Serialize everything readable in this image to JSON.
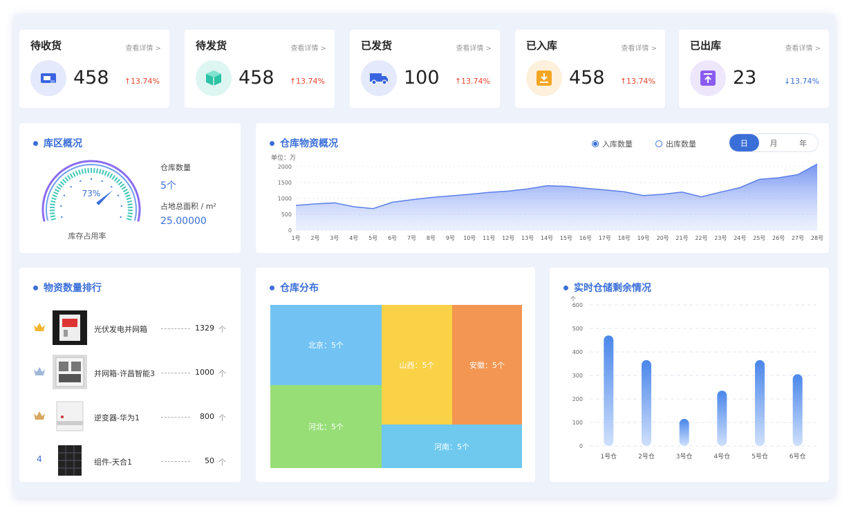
{
  "stats": [
    {
      "title": "待收货",
      "link": "查看详情 >",
      "value": "458",
      "change": "13.74%",
      "direction": "up",
      "icon": "inbox-icon",
      "icon_bg": "#e4e9fb",
      "icon_color": "#3a63e0"
    },
    {
      "title": "待发货",
      "link": "查看详情 >",
      "value": "458",
      "change": "13.74%",
      "direction": "up",
      "icon": "package-icon",
      "icon_bg": "#ddf6f1",
      "icon_color": "#2cc2a5"
    },
    {
      "title": "已发货",
      "link": "查看详情 >",
      "value": "100",
      "change": "13.74%",
      "direction": "up",
      "icon": "truck-icon",
      "icon_bg": "#e4e9fb",
      "icon_color": "#3a63e0"
    },
    {
      "title": "已入库",
      "link": "查看详情 >",
      "value": "458",
      "change": "13.74%",
      "direction": "up",
      "icon": "download-icon",
      "icon_bg": "#fdf0dc",
      "icon_color": "#f5a623"
    },
    {
      "title": "已出库",
      "link": "查看详情 >",
      "value": "23",
      "change": "13.74%",
      "direction": "down",
      "icon": "upload-icon",
      "icon_bg": "#eee7fc",
      "icon_color": "#8a5cf0"
    }
  ],
  "colors": {
    "up": "#e8432e",
    "down": "#3b6fd8",
    "accent": "#3b6fd8"
  },
  "zone": {
    "title": "库区概况",
    "gauge_percent": 73,
    "gauge_percent_label": "73%",
    "gauge_caption": "库存占用率",
    "count_label": "仓库数量",
    "count_value": "5个",
    "area_label": "占地总面积 / m²",
    "area_value": "25.00000"
  },
  "overview": {
    "title": "仓库物资概况",
    "legend_in": "入库数量",
    "legend_out": "出库数量",
    "unit": "单位：万",
    "toggles": [
      "日",
      "月",
      "年"
    ],
    "active_toggle": 0
  },
  "ranking": {
    "title": "物资数量排行",
    "items": [
      {
        "rank": "1",
        "name": "光伏发电并网箱",
        "value": "1329",
        "unit": "个",
        "medal": "#f3b530"
      },
      {
        "rank": "2",
        "name": "并网箱-许昌智能3",
        "value": "1000",
        "unit": "个",
        "medal": "#9fb8d8"
      },
      {
        "rank": "3",
        "name": "逆变器-华为1",
        "value": "800",
        "unit": "个",
        "medal": "#d8a860"
      },
      {
        "rank": "4",
        "name": "组件-天合1",
        "value": "50",
        "unit": "个",
        "medal": ""
      }
    ]
  },
  "distribution": {
    "title": "仓库分布",
    "cells": [
      {
        "label": "北京：5个",
        "color": "#72c3f4"
      },
      {
        "label": "山西：5个",
        "color": "#f9d248"
      },
      {
        "label": "安徽：5个",
        "color": "#f39652"
      },
      {
        "label": "河北：5个",
        "color": "#97de77"
      },
      {
        "label": "河南：5个",
        "color": "#6fc8ee"
      }
    ]
  },
  "remaining": {
    "title": "实时仓储剩余情况"
  },
  "chart_data": [
    {
      "type": "area",
      "title": "仓库物资概况",
      "ylabel": "单位：万",
      "ylim": [
        0,
        2000
      ],
      "yticks": [
        0,
        500,
        1000,
        1500,
        2000
      ],
      "grid": true,
      "x": [
        "1号",
        "2号",
        "3号",
        "4号",
        "5号",
        "6号",
        "7号",
        "8号",
        "9号",
        "10号",
        "11号",
        "12号",
        "13号",
        "14号",
        "15号",
        "16号",
        "17号",
        "18号",
        "19号",
        "20号",
        "21号",
        "22号",
        "23号",
        "24号",
        "25号",
        "26号",
        "27号",
        "28号"
      ],
      "series": [
        {
          "name": "入库数量",
          "values": [
            780,
            830,
            860,
            740,
            680,
            880,
            960,
            1030,
            1080,
            1130,
            1190,
            1230,
            1300,
            1400,
            1380,
            1320,
            1270,
            1210,
            1090,
            1130,
            1200,
            1050,
            1200,
            1340,
            1600,
            1650,
            1750,
            2080
          ]
        }
      ]
    },
    {
      "type": "bar",
      "title": "实时仓储剩余情况",
      "ylabel": "个",
      "ylim": [
        0,
        600
      ],
      "yticks": [
        0,
        100,
        200,
        300,
        400,
        500,
        600
      ],
      "grid": true,
      "categories": [
        "1号仓",
        "2号仓",
        "3号仓",
        "4号仓",
        "5号仓",
        "6号仓"
      ],
      "values": [
        470,
        365,
        115,
        235,
        365,
        305
      ]
    }
  ]
}
